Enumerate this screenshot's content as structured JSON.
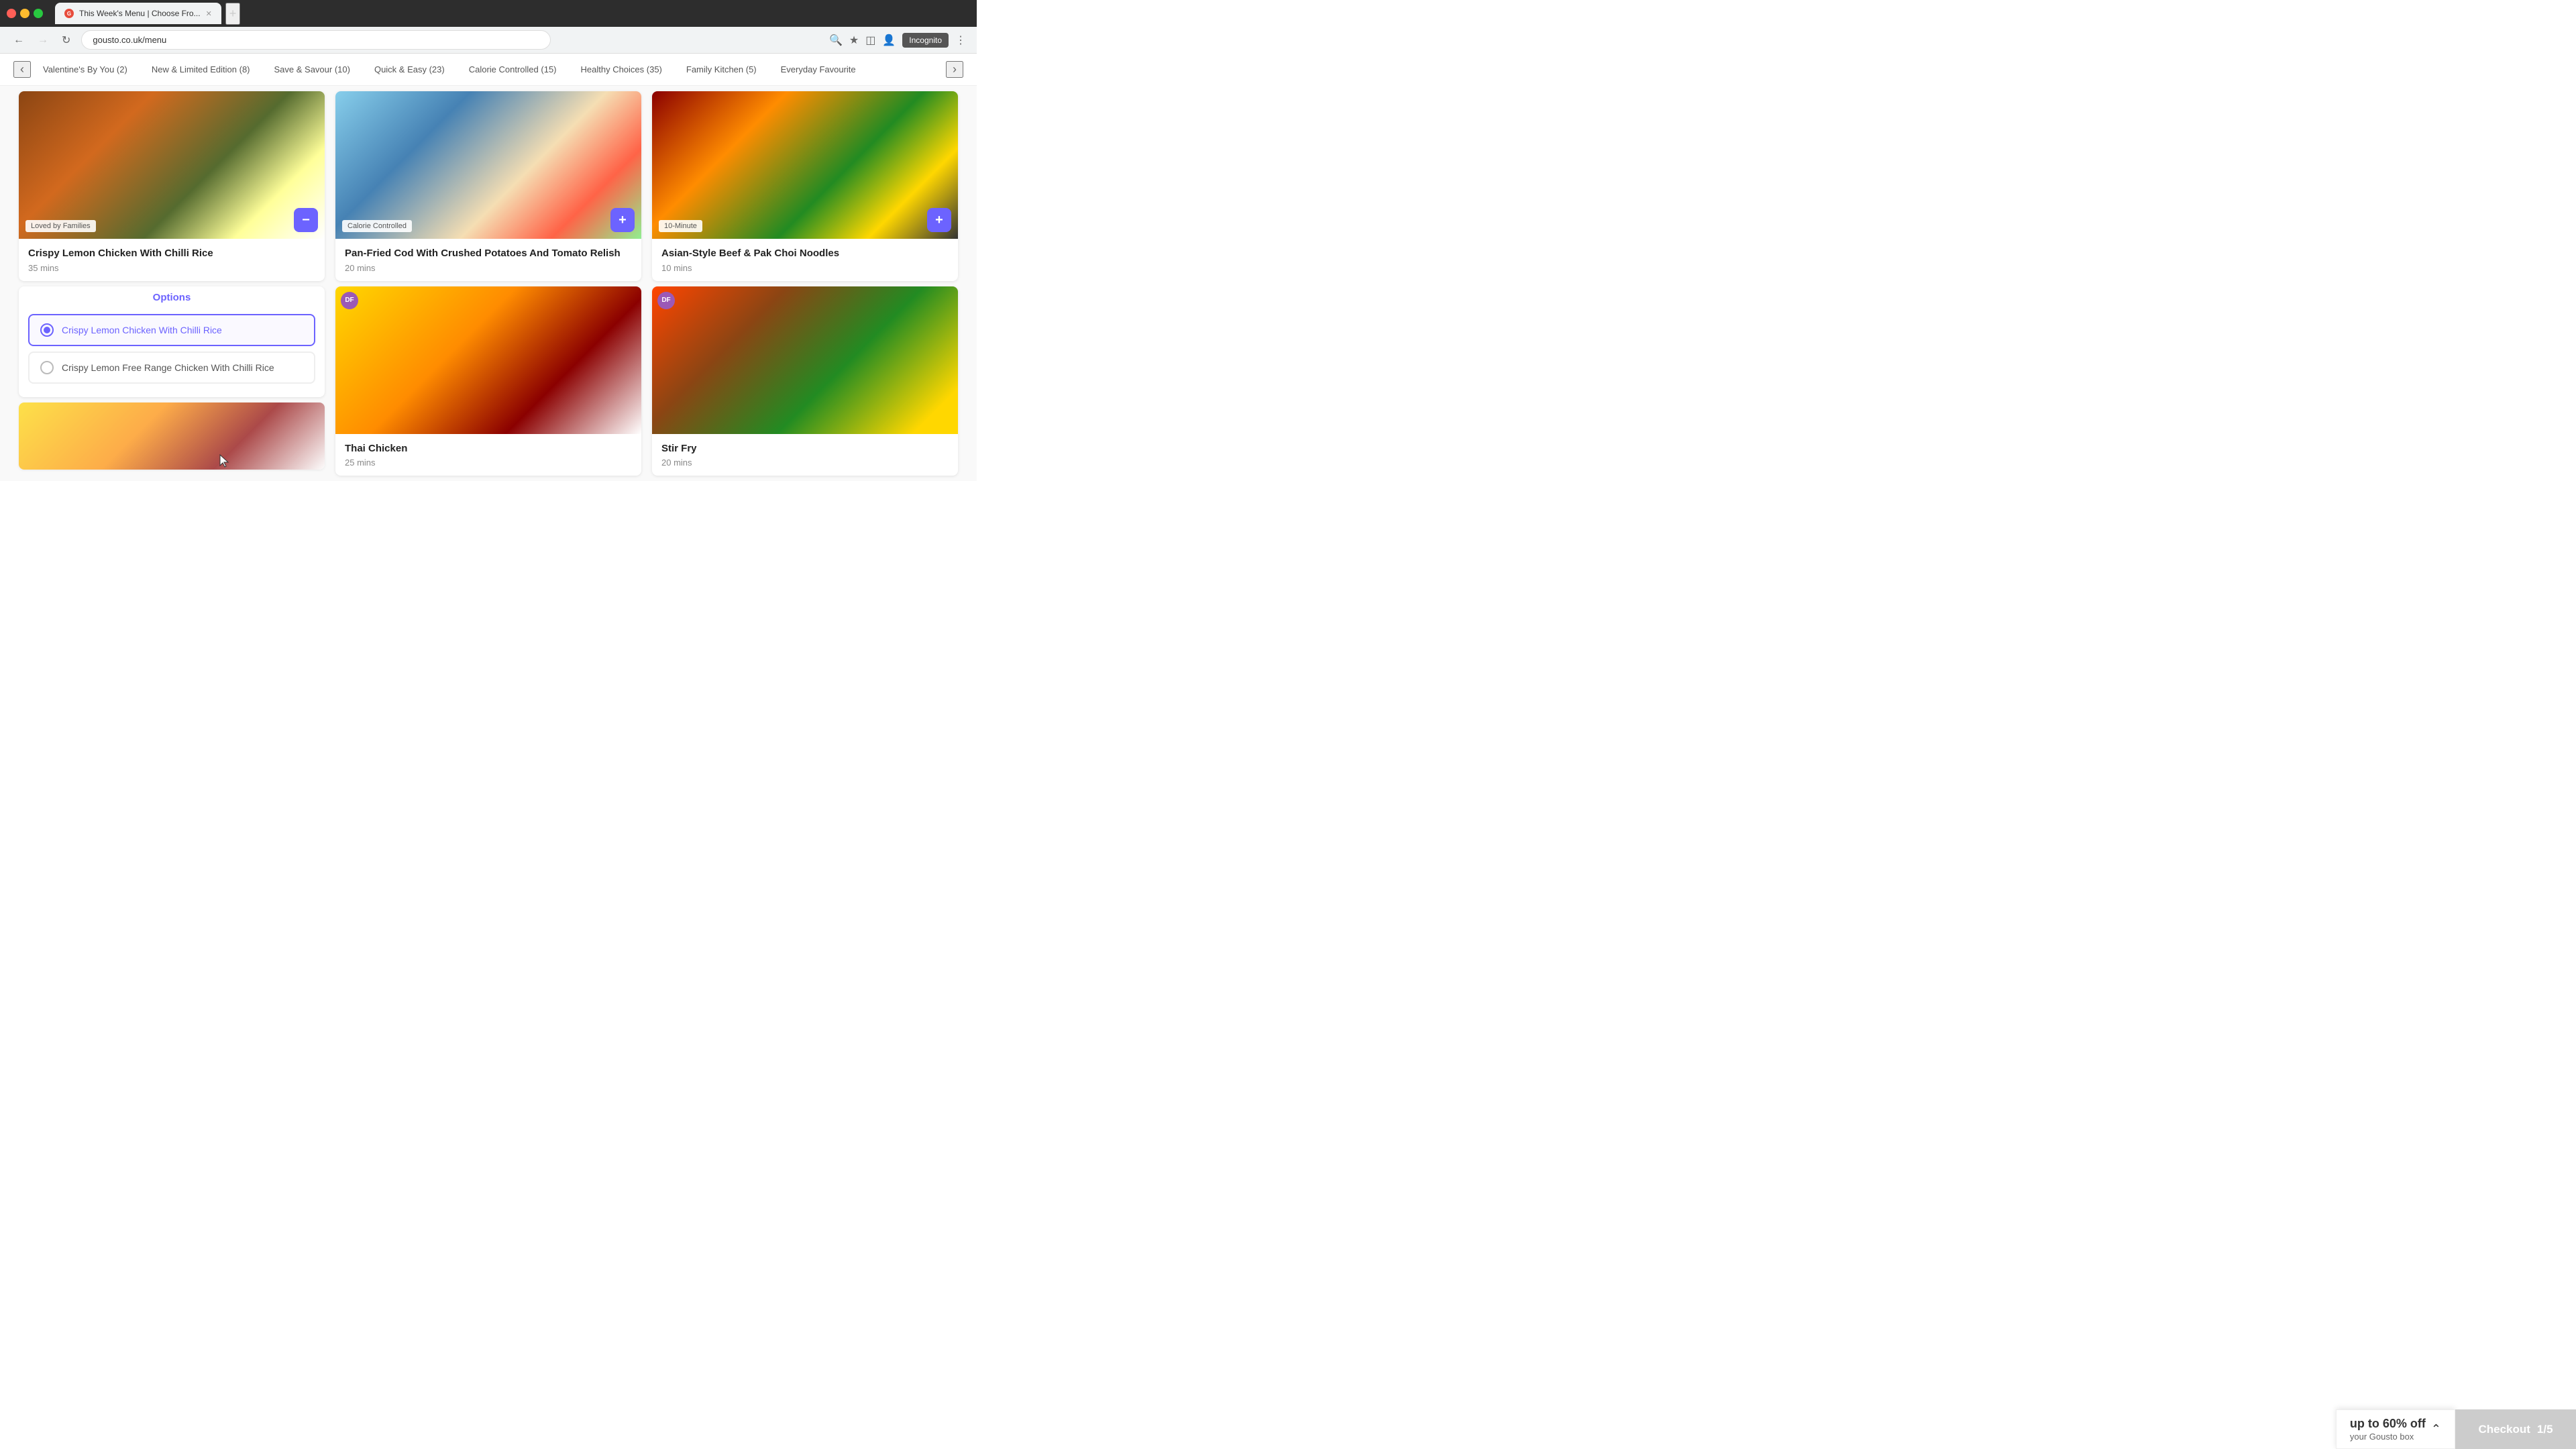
{
  "browser": {
    "tab_title": "This Week's Menu | Choose Fro...",
    "tab_favicon": "G",
    "url": "gousto.co.uk/menu",
    "incognito_label": "Incognito"
  },
  "category_nav": {
    "left_arrow": "‹",
    "right_arrow": "›",
    "items": [
      {
        "label": "Valentine's By You (2)",
        "id": "valentines"
      },
      {
        "label": "New & Limited Edition (8)",
        "id": "new-limited"
      },
      {
        "label": "Save & Savour (10)",
        "id": "save-savour"
      },
      {
        "label": "Quick & Easy (23)",
        "id": "quick-easy"
      },
      {
        "label": "Calorie Controlled (15)",
        "id": "calorie"
      },
      {
        "label": "Healthy Choices (35)",
        "id": "healthy"
      },
      {
        "label": "Family Kitchen (5)",
        "id": "family"
      },
      {
        "label": "Everyday Favourite",
        "id": "everyday"
      }
    ]
  },
  "cards": {
    "card1": {
      "badge": "Loved by Families",
      "title": "Crispy Lemon Chicken With Chilli Rice",
      "time": "35 mins",
      "action": "−",
      "has_options": true
    },
    "card2": {
      "badge": "Calorie Controlled",
      "title": "Pan-Fried Cod With Crushed Potatoes And Tomato Relish",
      "time": "20 mins",
      "action": "+"
    },
    "card3": {
      "badge": "10-Minute",
      "title": "Asian-Style Beef & Pak Choi Noodles",
      "time": "10 mins",
      "action": "+"
    },
    "card4": {
      "df_badge": "DF",
      "title": "Thai Chicken",
      "time": "25 mins"
    },
    "card5": {
      "df_badge": "DF",
      "title": "Stir Fry",
      "time": "20 mins"
    }
  },
  "options": {
    "title": "Options",
    "option1": {
      "label": "Crispy Lemon Chicken With Chilli Rice",
      "selected": true
    },
    "option2": {
      "label": "Crispy Lemon Free Range Chicken With Chilli Rice",
      "selected": false
    }
  },
  "bottom_bar": {
    "discount_percent": "up to 60% off",
    "discount_sub": "your Gousto box",
    "checkout_label": "Checkout",
    "checkout_count": "1/5"
  }
}
